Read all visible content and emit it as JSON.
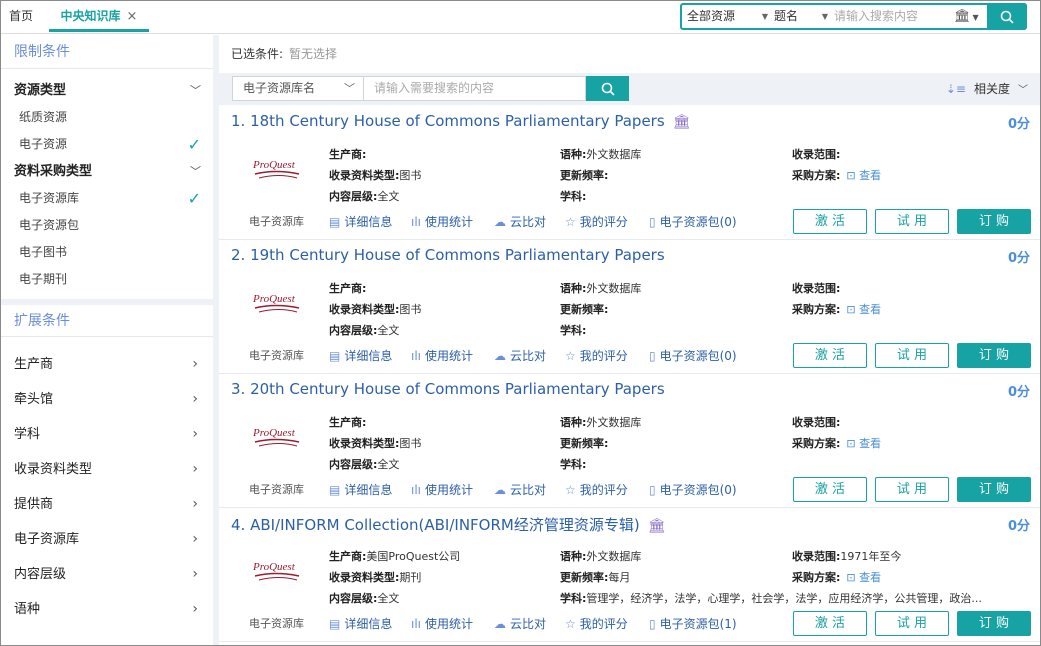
{
  "tabs": {
    "home": "首页",
    "active": "中央知识库",
    "close": "×"
  },
  "top_search": {
    "scope": "全部资源",
    "field": "题名",
    "placeholder": "请输入搜索内容"
  },
  "sidebar": {
    "limit_title": "限制条件",
    "groups": [
      {
        "label": "资源类型",
        "items": [
          {
            "label": "纸质资源",
            "checked": false
          },
          {
            "label": "电子资源",
            "checked": true
          }
        ]
      },
      {
        "label": "资料采购类型",
        "items": [
          {
            "label": "电子资源库",
            "checked": true
          },
          {
            "label": "电子资源包",
            "checked": false
          },
          {
            "label": "电子图书",
            "checked": false
          },
          {
            "label": "电子期刊",
            "checked": false
          }
        ]
      }
    ],
    "expand_title": "扩展条件",
    "expand_items": [
      "生产商",
      "牵头馆",
      "学科",
      "收录资料类型",
      "提供商",
      "电子资源库",
      "内容层级",
      "语种"
    ]
  },
  "main": {
    "selected_label": "已选条件:",
    "selected_value": "暂无选择",
    "filter_select": "电子资源库名",
    "filter_placeholder": "请输入需要搜索的内容",
    "sort_label": "相关度"
  },
  "field_labels": {
    "producer": "生产商:",
    "language": "语种:",
    "coverage": "收录范围:",
    "doc_type": "收录资料类型:",
    "frequency": "更新频率:",
    "purchase": "采购方案:",
    "content_level": "内容层级:",
    "subject": "学科:",
    "view": "查看"
  },
  "action_labels": {
    "detail": "详细信息",
    "stats": "使用统计",
    "cloud": "云比对",
    "rating": "我的评分",
    "activate": "激 活",
    "trial": "试 用",
    "order": "订 购"
  },
  "results": [
    {
      "title": "1. 18th Century House of Commons Parliamentary Papers",
      "has_library_icon": true,
      "score": "0分",
      "logo_text": "ProQuest",
      "producer": "",
      "language": "外文数据库",
      "coverage": "",
      "doc_type": "图书",
      "frequency": "",
      "content_level": "全文",
      "subject": "",
      "resource_type": "电子资源库",
      "package": "电子资源包(0)"
    },
    {
      "title": "2. 19th Century House of Commons Parliamentary Papers",
      "has_library_icon": false,
      "score": "0分",
      "logo_text": "ProQuest",
      "producer": "",
      "language": "外文数据库",
      "coverage": "",
      "doc_type": "图书",
      "frequency": "",
      "content_level": "全文",
      "subject": "",
      "resource_type": "电子资源库",
      "package": "电子资源包(0)"
    },
    {
      "title": "3. 20th Century House of Commons Parliamentary Papers",
      "has_library_icon": false,
      "score": "0分",
      "logo_text": "ProQuest",
      "producer": "",
      "language": "外文数据库",
      "coverage": "",
      "doc_type": "图书",
      "frequency": "",
      "content_level": "全文",
      "subject": "",
      "resource_type": "电子资源库",
      "package": "电子资源包(0)"
    },
    {
      "title": "4. ABI/INFORM Collection(ABI/INFORM经济管理资源专辑)",
      "has_library_icon": true,
      "score": "0分",
      "logo_text": "ProQuest",
      "producer": "美国ProQuest公司",
      "language": "外文数据库",
      "coverage": "1971年至今",
      "doc_type": "期刊",
      "frequency": "每月",
      "content_level": "全文",
      "subject": "管理学，经济学，法学，心理学，社会学，法学，应用经济学，公共管理，政治...",
      "resource_type": "电子资源库",
      "package": "电子资源包(1)"
    }
  ],
  "colors": {
    "accent": "#17a2a3",
    "link": "#2c5fa8",
    "sidebar_title": "#6a8fd8"
  }
}
